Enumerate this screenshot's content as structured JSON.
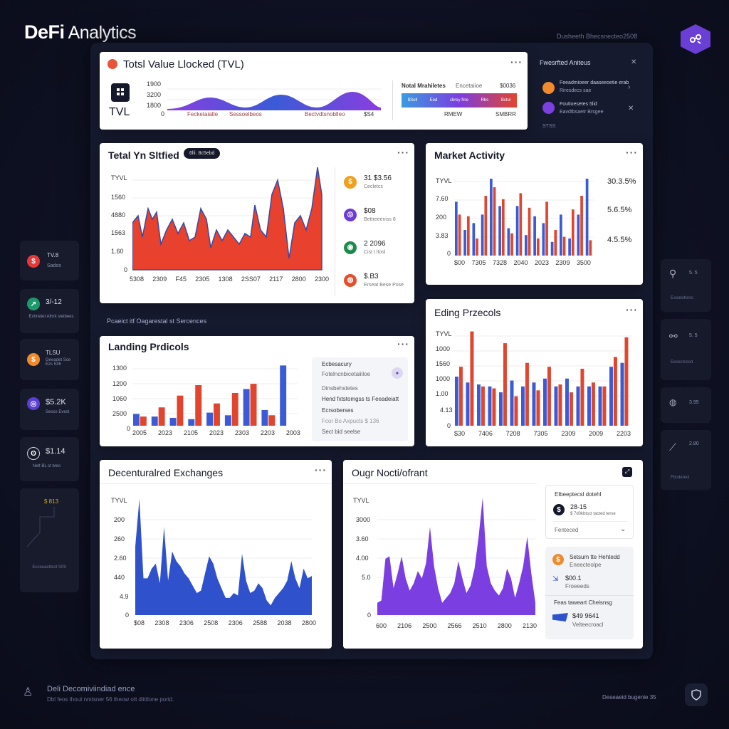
{
  "app": {
    "brand_bold": "DeFi",
    "brand_rest": " Analytics",
    "top_caption": "Dusheeth Bhecsnecteo2508"
  },
  "tvl_card": {
    "title": "Totsl Value Llocked (TVL)",
    "tile_label": "TVL",
    "y_ticks": [
      "1900",
      "3200",
      "1800",
      "0"
    ],
    "x_ticks": [
      "Fecketaiatle",
      "Sessoelbeos",
      "Bectvdtsnoblleo",
      "$S4"
    ],
    "legend_title": "Notal Mrahiletes",
    "legend_sub": "Encetaiioe",
    "legend_value": "$0036",
    "gradient_labels": [
      "$Sell",
      "Eed",
      "cbrey fine",
      "Rbs",
      "Bctul"
    ],
    "bottom_left": "RMEW",
    "bottom_right": "SMBRR"
  },
  "top_right_panel": {
    "title": "Fwesrfted Aniteus",
    "items": [
      {
        "title": "Feeadmioeer daaseeoetie erab",
        "sub": "Riresdecs sae",
        "color": "#f08a2c"
      },
      {
        "title": "Foutioesetes 5lid",
        "sub": "Eavdtbsaetr Brsgee",
        "color": "#7c3fe0"
      }
    ],
    "footnote": "STSS"
  },
  "tvs_card": {
    "title": "Tetal Yn Sltfied",
    "badge": "6lli. 8c5ebd",
    "y_ticks": [
      "TYVL",
      "1560",
      "4880",
      "1563",
      "1.60",
      "0"
    ],
    "x_ticks": [
      "5308",
      "2309",
      "F45",
      "2305",
      "1308",
      "2SS07",
      "2117",
      "2800",
      "2300"
    ],
    "stats": [
      {
        "value": "31  $3.56",
        "sub": "Cecletcs",
        "color": "#f0a020"
      },
      {
        "value": "$08",
        "sub": "Bettreeeniss 8",
        "color": "#6b3bd6"
      },
      {
        "value": "2 2096",
        "sub": "Cist t ltosl",
        "color": "#1c8a4a"
      },
      {
        "value": "$.B3",
        "sub": "Erseat Bese Pose",
        "color": "#e2502c"
      }
    ]
  },
  "market_card": {
    "title": "Market Activity",
    "y_ticks": [
      "TYVL",
      "7.60",
      "200",
      "3.83",
      "0"
    ],
    "x_ticks": [
      "$00",
      "7305",
      "7328",
      "2040",
      "2023",
      "2309",
      "3500"
    ],
    "pcts": [
      "30.3.5%",
      "5.6.5%",
      "4.5.5%"
    ],
    "series": [
      {
        "name": "Blue",
        "color": "#3b5bd6",
        "values": [
          63,
          30,
          38,
          48,
          90,
          58,
          32,
          58,
          24,
          46,
          38,
          16,
          48,
          20,
          48,
          90
        ]
      },
      {
        "name": "Red",
        "color": "#e2452e",
        "values": [
          48,
          46,
          20,
          70,
          80,
          66,
          26,
          73,
          56,
          20,
          63,
          30,
          22,
          54,
          70,
          18
        ]
      }
    ]
  },
  "section_caption": "Pcaeict itf Oagarestal st Sercences",
  "lending_card": {
    "title": "Landing Prdicols",
    "y_ticks": [
      "1300",
      "1200",
      "1060",
      "2500",
      "0"
    ],
    "x_ticks": [
      "2005",
      "2023",
      "2105",
      "2023",
      "2303",
      "2203",
      "2003"
    ],
    "series": [
      {
        "name": "Blue",
        "color": "#3b5bd6",
        "values": [
          18,
          14,
          12,
          10,
          20,
          16,
          56,
          24,
          92
        ]
      },
      {
        "name": "Red",
        "color": "#e2452e",
        "values": [
          14,
          28,
          46,
          62,
          34,
          50,
          64,
          16,
          0
        ]
      }
    ],
    "side": {
      "head": "Ecbesacury",
      "line1": "Fotelncnbicetaiiiloe",
      "line2": "Dinsbehstetes",
      "line3": "Hend fxtstomgss ts Feeadeiatt",
      "line4": "Ecrsoberses",
      "line5": "Fcor Bo Axpucts  $ 136",
      "line6": "Sect bid seelse"
    }
  },
  "eding_card": {
    "title": "Eding Przecols",
    "y_ticks": [
      "TYVL",
      "1000",
      "1560",
      "1000",
      "1.00",
      "4.13",
      "0"
    ],
    "x_ticks": [
      "$30",
      "7406",
      "7208",
      "7305",
      "2309",
      "2009",
      "2203"
    ],
    "series": [
      {
        "name": "Blue",
        "color": "#3b5bd6",
        "values": [
          50,
          44,
          42,
          40,
          34,
          46,
          40,
          44,
          48,
          40,
          48,
          40,
          40,
          40,
          60,
          64
        ]
      },
      {
        "name": "Red",
        "color": "#e2452e",
        "values": [
          60,
          96,
          40,
          38,
          84,
          30,
          64,
          36,
          60,
          42,
          34,
          58,
          44,
          40,
          70,
          90
        ]
      }
    ]
  },
  "dex_card": {
    "title": "Decenturalred Exchanges",
    "y_ticks": [
      "TYVL",
      "200",
      "260",
      "2.60",
      "440",
      "4.9",
      "0"
    ],
    "x_ticks": [
      "$08",
      "2308",
      "2306",
      "2508",
      "2306",
      "2588",
      "2038",
      "2800"
    ],
    "color": "#2f52cc",
    "values": [
      56,
      95,
      30,
      30,
      38,
      42,
      26,
      72,
      28,
      52,
      44,
      40,
      34,
      30,
      24,
      18,
      20,
      34,
      48,
      42,
      30,
      22,
      14,
      14,
      18,
      16,
      50,
      28,
      18,
      20,
      26,
      22,
      12,
      8,
      14,
      18,
      22,
      28,
      44,
      30,
      22,
      38,
      30,
      32
    ]
  },
  "ougr_card": {
    "title": "Ougr Nocti/ofrant",
    "y_ticks": [
      "TYVL",
      "3000",
      "3.60",
      "4.00",
      "5.0",
      "0"
    ],
    "x_ticks": [
      "600",
      "2106",
      "2500",
      "2566",
      "2510",
      "2800",
      "2130"
    ],
    "color": "#7b3ee0",
    "values": [
      10,
      12,
      46,
      48,
      22,
      34,
      48,
      30,
      20,
      26,
      36,
      30,
      42,
      72,
      40,
      22,
      10,
      14,
      18,
      26,
      44,
      30,
      18,
      24,
      38,
      64,
      96,
      40,
      26,
      20,
      16,
      22,
      38,
      30,
      14,
      26,
      40,
      64,
      34,
      10
    ]
  },
  "ougr_side": {
    "box1_title": "Elbeeptecsl dotehl",
    "box1_value": "28-15",
    "box1_sub": "$ 7d0kbtsct tacted terse",
    "box1_footer": "Fenteced",
    "box2_title": "Setsum tte Hehtedd",
    "box2_sub": "Eneecteolpe",
    "box2_value": "$00.1",
    "box2_value_sub": "Froeeeds",
    "box3_title": "Feas taweart Cheisnsg",
    "box3_value": "$49 9641",
    "box3_sub": "Velteecroacl"
  },
  "sidebar_left": [
    {
      "value": "TV.8",
      "sub": "Sados",
      "color": "#e23a3a"
    },
    {
      "value": "3/-12",
      "sub": "Exhrietet Athrit steibees",
      "color": "#1d9a6c"
    },
    {
      "value": "TLSU",
      "sub": "Geeadet Sce Ezs 536",
      "color": "#f08a2c"
    },
    {
      "value": "$5.2K",
      "sub": "Seoss Evest",
      "color": "#5a3fd6"
    },
    {
      "value": "$1.14",
      "sub": "Nelt BL st bres",
      "color": "#8888aa"
    },
    {
      "value": "$ 813",
      "sub": "Ecceeaetteot S09",
      "color": "#c8a820"
    }
  ],
  "sidebar_right": [
    {
      "value": "5. 5",
      "sub": "Eseatohens"
    },
    {
      "value": "5. 5",
      "sub": "Eecectcood"
    },
    {
      "value": "3.95",
      "sub": ""
    },
    {
      "value": "2.80",
      "sub": "Fbcderecl"
    }
  ],
  "footer": {
    "title": "Deli Decomiviindiad ence",
    "sub": "Dbl feos thout nmtsner 56 theow ott diittlone porid.",
    "right": "Deseaeid bugenie 35"
  }
}
